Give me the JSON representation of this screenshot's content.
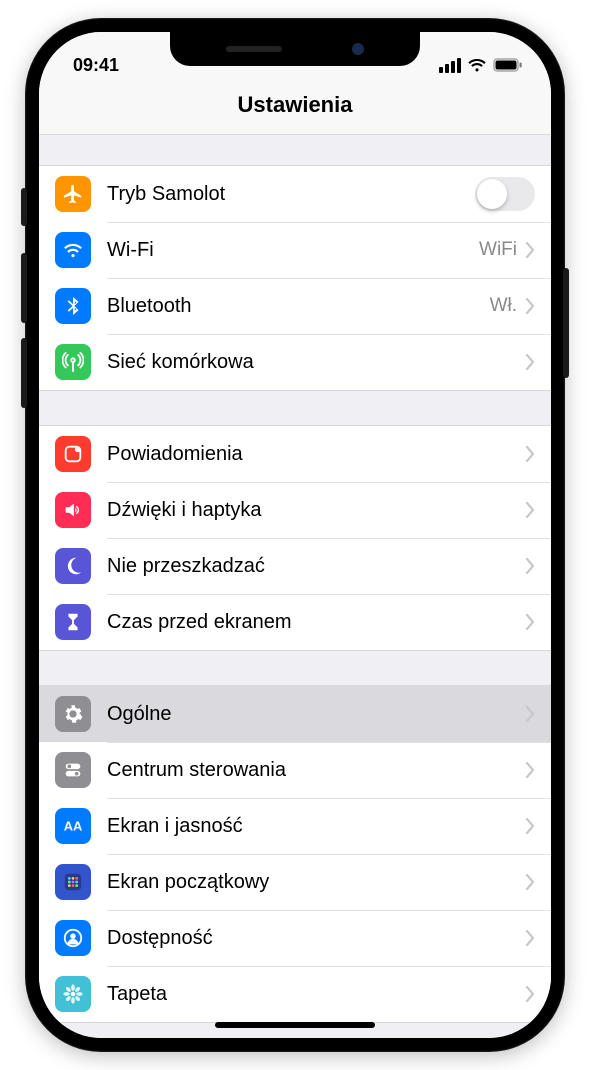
{
  "status": {
    "time": "09:41"
  },
  "header": {
    "title": "Ustawienia"
  },
  "groups": [
    {
      "rows": [
        {
          "id": "airplane",
          "icon": "airplane-icon",
          "color": "#ff9500",
          "label": "Tryb Samolot",
          "type": "toggle",
          "on": false
        },
        {
          "id": "wifi",
          "icon": "wifi-icon",
          "color": "#007aff",
          "label": "Wi-Fi",
          "type": "link",
          "value": "WiFi"
        },
        {
          "id": "bluetooth",
          "icon": "bluetooth-icon",
          "color": "#007aff",
          "label": "Bluetooth",
          "type": "link",
          "value": "Wł."
        },
        {
          "id": "cellular",
          "icon": "antenna-icon",
          "color": "#34c759",
          "label": "Sieć komórkowa",
          "type": "link"
        }
      ]
    },
    {
      "rows": [
        {
          "id": "notifications",
          "icon": "bell-icon",
          "color": "#ff3b30",
          "label": "Powiadomienia",
          "type": "link"
        },
        {
          "id": "sounds",
          "icon": "speaker-icon",
          "color": "#ff2d55",
          "label": "Dźwięki i haptyka",
          "type": "link"
        },
        {
          "id": "dnd",
          "icon": "moon-icon",
          "color": "#5856d6",
          "label": "Nie przeszkadzać",
          "type": "link"
        },
        {
          "id": "screentime",
          "icon": "hourglass-icon",
          "color": "#5856d6",
          "label": "Czas przed ekranem",
          "type": "link"
        }
      ]
    },
    {
      "rows": [
        {
          "id": "general",
          "icon": "gear-icon",
          "color": "#8e8e93",
          "label": "Ogólne",
          "type": "link",
          "selected": true
        },
        {
          "id": "control",
          "icon": "switches-icon",
          "color": "#8e8e93",
          "label": "Centrum sterowania",
          "type": "link"
        },
        {
          "id": "display",
          "icon": "aa-icon",
          "color": "#007aff",
          "label": "Ekran i jasność",
          "type": "link"
        },
        {
          "id": "home",
          "icon": "grid-icon",
          "color": "#3355cc",
          "label": "Ekran początkowy",
          "type": "link"
        },
        {
          "id": "accessibility",
          "icon": "person-icon",
          "color": "#007aff",
          "label": "Dostępność",
          "type": "link"
        },
        {
          "id": "wallpaper",
          "icon": "flower-icon",
          "color": "#42c0d6",
          "label": "Tapeta",
          "type": "link"
        }
      ]
    }
  ]
}
